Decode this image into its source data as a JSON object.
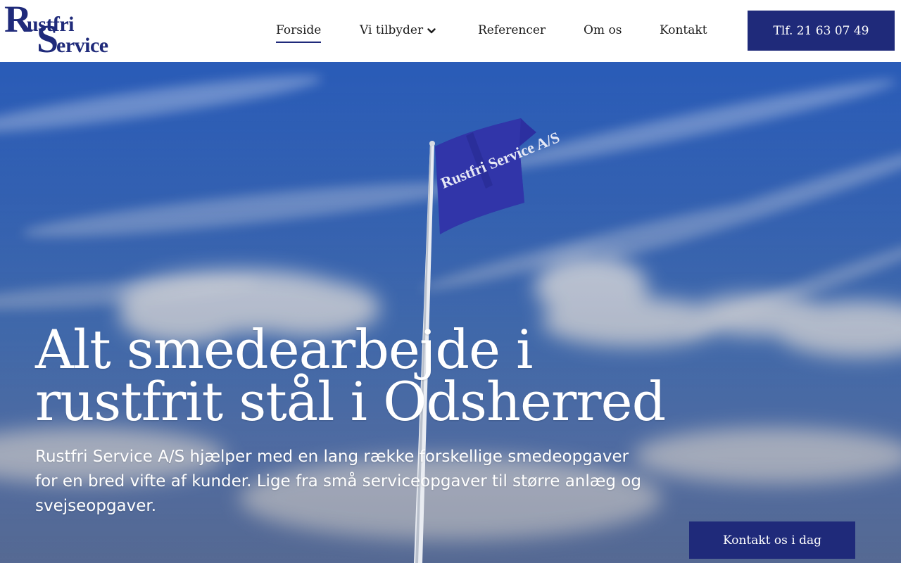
{
  "brand": {
    "logo_r": "R",
    "logo_ustfri": "ustfri",
    "logo_s": "S",
    "logo_ervice": "ervice",
    "color": "#1f2a7a"
  },
  "nav": {
    "items": [
      {
        "label": "Forside",
        "active": true
      },
      {
        "label": "Vi tilbyder",
        "has_dropdown": true,
        "icon": "chevron-down-icon"
      },
      {
        "label": "Referencer"
      },
      {
        "label": "Om os"
      },
      {
        "label": "Kontakt"
      }
    ],
    "phone_label": "Tlf. 21 63 07 49"
  },
  "hero": {
    "title_line1": "Alt smedearbejde i",
    "title_line2": "rustfrit stål i Odsherred",
    "text": "Rustfri Service A/S hjælper med en lang række forskellige smedeopgaver for en bred vifte af kunder. Lige fra små serviceopgaver til større anlæg og svejseopgaver.",
    "cta_label": "Kontakt os i dag",
    "flag_logo_text": "Rustfri Service A/S"
  }
}
